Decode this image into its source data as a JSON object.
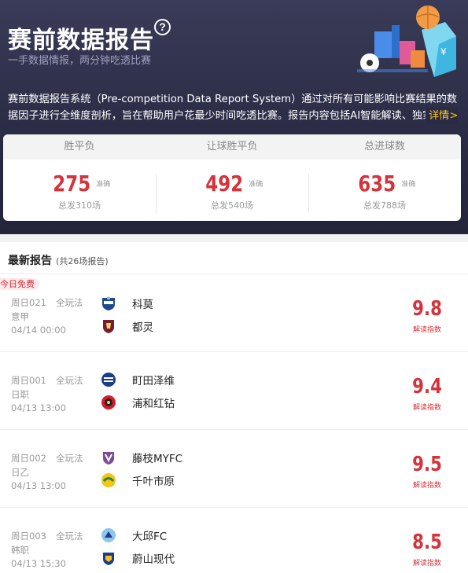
{
  "header": {
    "title": "赛前数据报告",
    "help_icon": "?",
    "subtitle": "一手数据情报，两分钟吃透比赛",
    "description": "赛前数据报告系统（Pre-competition Data Report System）通过对所有可能影响比赛结果的数据因子进行全维度剖析，旨在帮助用户花最少时间吃透比赛。报告内容包括AI智能解读、独家临场",
    "more_link": "详情>"
  },
  "stats": [
    {
      "label": "胜平负",
      "value": "275",
      "unit": "准确",
      "total": "总发310场"
    },
    {
      "label": "让球胜平负",
      "value": "492",
      "unit": "准确",
      "total": "总发540场"
    },
    {
      "label": "总进球数",
      "value": "635",
      "unit": "准确",
      "total": "总发788场"
    }
  ],
  "list": {
    "title": "最新报告",
    "count": "(共26场报告)",
    "free_badge": "今日免费",
    "score_label": "解读指数",
    "items": [
      {
        "code": "周日021",
        "play": "全玩法",
        "league": "意甲",
        "time": "04/14 00:00",
        "home": "科莫",
        "away": "都灵",
        "score": "9.8",
        "home_icon": "como-crest-icon",
        "away_icon": "torino-crest-icon"
      },
      {
        "code": "周日001",
        "play": "全玩法",
        "league": "日职",
        "time": "04/13 13:00",
        "home": "町田泽维",
        "away": "浦和红钻",
        "score": "9.4",
        "home_icon": "machida-crest-icon",
        "away_icon": "urawa-crest-icon"
      },
      {
        "code": "周日002",
        "play": "全玩法",
        "league": "日乙",
        "time": "04/13 13:00",
        "home": "藤枝MYFC",
        "away": "千叶市原",
        "score": "9.5",
        "home_icon": "fujieda-crest-icon",
        "away_icon": "chiba-crest-icon"
      },
      {
        "code": "周日003",
        "play": "全玩法",
        "league": "韩职",
        "time": "04/13 15:30",
        "home": "大邱FC",
        "away": "蔚山现代",
        "score": "8.5",
        "home_icon": "daegu-crest-icon",
        "away_icon": "ulsan-crest-icon"
      }
    ]
  },
  "colors": {
    "accent": "#d5323a",
    "header_bg": "#2b2c45",
    "link": "#f5c518"
  }
}
